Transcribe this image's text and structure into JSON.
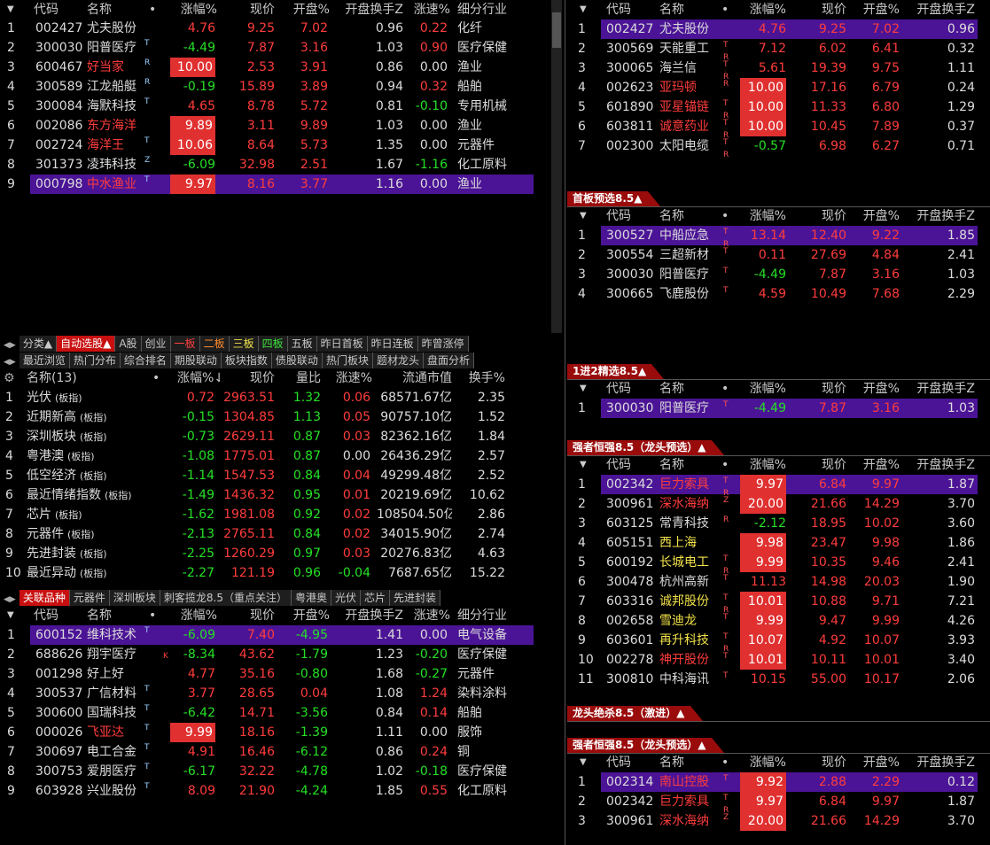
{
  "top_left": {
    "headers": [
      "代码",
      "名称",
      "•",
      "涨幅%",
      "现价",
      "开盘%",
      "开盘换手Z",
      "涨速%",
      "细分行业"
    ],
    "rows": [
      {
        "i": "1",
        "code": "002427",
        "name": "尤夫股份",
        "tag": "",
        "zf": "4.76",
        "xj": "9.25",
        "kp": "7.02",
        "hs": "0.96",
        "zs": "0.22",
        "hy": "化纤",
        "zfc": "red",
        "kpc": "red",
        "zsc": "red",
        "nc": "wht"
      },
      {
        "i": "2",
        "code": "300030",
        "name": "阳普医疗",
        "tag": "T",
        "zf": "-4.49",
        "xj": "7.87",
        "kp": "3.16",
        "hs": "1.03",
        "zs": "0.90",
        "hy": "医疗保健",
        "zfc": "grn",
        "kpc": "red",
        "zsc": "red",
        "nc": "wht"
      },
      {
        "i": "3",
        "code": "600467",
        "name": "好当家",
        "tag": "R",
        "zf": "10.00",
        "xj": "2.53",
        "kp": "3.91",
        "hs": "0.86",
        "zs": "0.00",
        "hy": "渔业",
        "zfc": "box",
        "kpc": "red",
        "zsc": "wht",
        "nc": "red"
      },
      {
        "i": "4",
        "code": "300589",
        "name": "江龙船艇",
        "tag": "R",
        "zf": "-0.19",
        "xj": "15.89",
        "kp": "3.89",
        "hs": "0.94",
        "zs": "0.32",
        "hy": "船舶",
        "zfc": "grn",
        "kpc": "red",
        "zsc": "red",
        "nc": "wht"
      },
      {
        "i": "5",
        "code": "300084",
        "name": "海默科技",
        "tag": "T",
        "zf": "4.65",
        "xj": "8.78",
        "kp": "5.72",
        "hs": "0.81",
        "zs": "-0.10",
        "hy": "专用机械",
        "zfc": "red",
        "kpc": "red",
        "zsc": "grn",
        "nc": "wht"
      },
      {
        "i": "6",
        "code": "002086",
        "name": "东方海洋",
        "tag": "",
        "zf": "9.89",
        "xj": "3.11",
        "kp": "9.89",
        "hs": "1.03",
        "zs": "0.00",
        "hy": "渔业",
        "zfc": "box",
        "kpc": "red",
        "zsc": "wht",
        "nc": "red"
      },
      {
        "i": "7",
        "code": "002724",
        "name": "海洋王",
        "tag": "T",
        "zf": "10.06",
        "xj": "8.64",
        "kp": "5.73",
        "hs": "1.35",
        "zs": "0.00",
        "hy": "元器件",
        "zfc": "box",
        "kpc": "red",
        "zsc": "wht",
        "nc": "red"
      },
      {
        "i": "8",
        "code": "301373",
        "name": "凌玮科技",
        "tag": "Z",
        "zf": "-6.09",
        "xj": "32.98",
        "kp": "2.51",
        "hs": "1.67",
        "zs": "-1.16",
        "hy": "化工原料",
        "zfc": "grn",
        "kpc": "red",
        "zsc": "grn",
        "nc": "wht"
      },
      {
        "i": "9",
        "code": "000798",
        "name": "中水渔业",
        "tag": "T",
        "zf": "9.97",
        "xj": "8.16",
        "kp": "3.77",
        "hs": "1.16",
        "zs": "0.00",
        "hy": "渔业",
        "zfc": "box",
        "kpc": "red",
        "zsc": "wht",
        "nc": "red",
        "sel": true
      }
    ]
  },
  "tabs_row1": [
    "分类▲",
    "自动选股▲",
    "A股",
    "创业",
    "一板",
    "二板",
    "三板",
    "四板",
    "五板",
    "昨日首板",
    "昨日连板",
    "昨曾涨停"
  ],
  "tabs_row2": [
    "最近浏览",
    "热门分布",
    "综合排名",
    "期股联动",
    "板块指数",
    "债股联动",
    "热门板块",
    "题材龙头",
    "盘面分析"
  ],
  "mid_left": {
    "headers": [
      "名称(13)",
      "•",
      "涨幅%↓",
      "现价",
      "量比",
      "涨速%",
      "流通市值",
      "换手%"
    ],
    "rows": [
      {
        "i": "1",
        "name": "光伏",
        "zf": "0.72",
        "xj": "2963.51",
        "lb": "1.32",
        "zs": "0.06",
        "sz": "68571.67亿",
        "hs": "2.35",
        "zfc": "red",
        "zsc": "red"
      },
      {
        "i": "2",
        "name": "近期新高",
        "zf": "-0.15",
        "xj": "1304.85",
        "lb": "1.13",
        "zs": "0.05",
        "sz": "90757.10亿",
        "hs": "1.52",
        "zfc": "grn",
        "zsc": "red"
      },
      {
        "i": "3",
        "name": "深圳板块",
        "zf": "-0.73",
        "xj": "2629.11",
        "lb": "0.87",
        "zs": "0.03",
        "sz": "82362.16亿",
        "hs": "1.84",
        "zfc": "grn",
        "zsc": "red"
      },
      {
        "i": "4",
        "name": "粤港澳",
        "zf": "-1.08",
        "xj": "1775.01",
        "lb": "0.87",
        "zs": "0.00",
        "sz": "26436.29亿",
        "hs": "2.57",
        "zfc": "grn",
        "zsc": "wht"
      },
      {
        "i": "5",
        "name": "低空经济",
        "zf": "-1.14",
        "xj": "1547.53",
        "lb": "0.84",
        "zs": "0.04",
        "sz": "49299.48亿",
        "hs": "2.52",
        "zfc": "grn",
        "zsc": "red"
      },
      {
        "i": "6",
        "name": "最近情绪指数",
        "zf": "-1.49",
        "xj": "1436.32",
        "lb": "0.95",
        "zs": "0.01",
        "sz": "20219.69亿",
        "hs": "10.62",
        "zfc": "grn",
        "zsc": "red"
      },
      {
        "i": "7",
        "name": "芯片",
        "zf": "-1.62",
        "xj": "1981.08",
        "lb": "0.92",
        "zs": "0.02",
        "sz": "108504.50亿",
        "hs": "2.86",
        "zfc": "grn",
        "zsc": "red"
      },
      {
        "i": "8",
        "name": "元器件",
        "zf": "-2.13",
        "xj": "2765.11",
        "lb": "0.84",
        "zs": "0.02",
        "sz": "34015.90亿",
        "hs": "2.74",
        "zfc": "grn",
        "zsc": "red"
      },
      {
        "i": "9",
        "name": "先进封装",
        "zf": "-2.25",
        "xj": "1260.29",
        "lb": "0.97",
        "zs": "0.03",
        "sz": "20276.83亿",
        "hs": "4.63",
        "zfc": "grn",
        "zsc": "red"
      },
      {
        "i": "10",
        "name": "最近异动",
        "zf": "-2.27",
        "xj": "121.19",
        "lb": "0.96",
        "zs": "-0.04",
        "sz": "7687.65亿",
        "hs": "15.22",
        "zfc": "grn",
        "zsc": "grn"
      }
    ],
    "suffix": "(板指)"
  },
  "tabs_row3": [
    "关联品种",
    "元器件",
    "深圳板块",
    "刺客揽龙8.5（重点关注）",
    "粤港奥",
    "光伏",
    "芯片",
    "先进封装"
  ],
  "bot_left": {
    "headers": [
      "代码",
      "名称",
      "•",
      "涨幅%",
      "现价",
      "开盘%",
      "开盘换手Z",
      "涨速%",
      "细分行业"
    ],
    "rows": [
      {
        "i": "1",
        "code": "600152",
        "name": "维科技术",
        "tag": "T",
        "zf": "-6.09",
        "xj": "7.40",
        "kp": "-4.95",
        "hs": "1.41",
        "zs": "0.00",
        "hy": "电气设备",
        "zfc": "grn",
        "kpc": "grn",
        "zsc": "wht",
        "nc": "wht",
        "sel": true
      },
      {
        "i": "2",
        "code": "688626",
        "name": "翔宇医疗",
        "tag": "K",
        "zf": "-8.34",
        "xj": "43.62",
        "kp": "-1.79",
        "hs": "1.23",
        "zs": "-0.20",
        "hy": "医疗保健",
        "zfc": "grn",
        "kpc": "grn",
        "zsc": "grn",
        "nc": "wht"
      },
      {
        "i": "3",
        "code": "001298",
        "name": "好上好",
        "tag": "",
        "zf": "4.77",
        "xj": "35.16",
        "kp": "-0.80",
        "hs": "1.68",
        "zs": "-0.27",
        "hy": "元器件",
        "zfc": "red",
        "kpc": "grn",
        "zsc": "grn",
        "nc": "wht"
      },
      {
        "i": "4",
        "code": "300537",
        "name": "广信材料",
        "tag": "T",
        "zf": "3.77",
        "xj": "28.65",
        "kp": "0.04",
        "hs": "1.08",
        "zs": "1.24",
        "hy": "染料涂料",
        "zfc": "red",
        "kpc": "red",
        "zsc": "red",
        "nc": "wht"
      },
      {
        "i": "5",
        "code": "300600",
        "name": "国瑞科技",
        "tag": "T",
        "zf": "-6.42",
        "xj": "14.71",
        "kp": "-3.56",
        "hs": "0.84",
        "zs": "0.14",
        "hy": "船舶",
        "zfc": "grn",
        "kpc": "grn",
        "zsc": "red",
        "nc": "wht"
      },
      {
        "i": "6",
        "code": "000026",
        "name": "飞亚达",
        "tag": "T",
        "zf": "9.99",
        "xj": "18.16",
        "kp": "-1.39",
        "hs": "1.11",
        "zs": "0.00",
        "hy": "服饰",
        "zfc": "box",
        "kpc": "grn",
        "zsc": "wht",
        "nc": "red"
      },
      {
        "i": "7",
        "code": "300697",
        "name": "电工合金",
        "tag": "T",
        "zf": "4.91",
        "xj": "16.46",
        "kp": "-6.12",
        "hs": "0.86",
        "zs": "0.24",
        "hy": "铜",
        "zfc": "red",
        "kpc": "grn",
        "zsc": "red",
        "nc": "wht"
      },
      {
        "i": "8",
        "code": "300753",
        "name": "爱朋医疗",
        "tag": "T",
        "zf": "-6.17",
        "xj": "32.22",
        "kp": "-4.78",
        "hs": "1.02",
        "zs": "-0.18",
        "hy": "医疗保健",
        "zfc": "grn",
        "kpc": "grn",
        "zsc": "grn",
        "nc": "wht"
      },
      {
        "i": "9",
        "code": "603928",
        "name": "兴业股份",
        "tag": "T",
        "zf": "8.09",
        "xj": "21.90",
        "kp": "-4.24",
        "hs": "1.85",
        "zs": "0.55",
        "hy": "化工原料",
        "zfc": "red",
        "kpc": "grn",
        "zsc": "red",
        "nc": "wht"
      }
    ]
  },
  "right_headers": [
    "代码",
    "名称",
    "•",
    "涨幅%",
    "现价",
    "开盘%",
    "开盘换手Z"
  ],
  "right_groups": [
    {
      "title": "",
      "rows": [
        {
          "i": "1",
          "code": "002427",
          "name": "尤夫股份",
          "tag": "",
          "zf": "4.76",
          "xj": "9.25",
          "kp": "7.02",
          "hs": "0.96",
          "zfc": "red",
          "nc": "wht",
          "sel": true
        },
        {
          "i": "2",
          "code": "300569",
          "name": "天能重工",
          "tag": "T R",
          "zf": "7.12",
          "xj": "6.02",
          "kp": "6.41",
          "hs": "0.32",
          "zfc": "red",
          "nc": "wht"
        },
        {
          "i": "3",
          "code": "300065",
          "name": "海兰信",
          "tag": "T R",
          "zf": "5.61",
          "xj": "19.39",
          "kp": "9.75",
          "hs": "1.11",
          "zfc": "red",
          "nc": "wht"
        },
        {
          "i": "4",
          "code": "002623",
          "name": "亚玛顿",
          "tag": "R",
          "zf": "10.00",
          "xj": "17.16",
          "kp": "6.79",
          "hs": "0.24",
          "zfc": "box",
          "nc": "red"
        },
        {
          "i": "5",
          "code": "601890",
          "name": "亚星锚链",
          "tag": "T R",
          "zf": "10.00",
          "xj": "11.33",
          "kp": "6.80",
          "hs": "1.29",
          "zfc": "box",
          "nc": "red"
        },
        {
          "i": "6",
          "code": "603811",
          "name": "诚意药业",
          "tag": "T R",
          "zf": "10.00",
          "xj": "10.45",
          "kp": "7.89",
          "hs": "0.37",
          "zfc": "box",
          "nc": "red"
        },
        {
          "i": "7",
          "code": "002300",
          "name": "太阳电缆",
          "tag": "T R",
          "zf": "-0.57",
          "xj": "6.98",
          "kp": "6.27",
          "hs": "0.71",
          "zfc": "grn",
          "nc": "wht"
        }
      ]
    },
    {
      "title": "首板预选8.5▲",
      "rows": [
        {
          "i": "1",
          "code": "300527",
          "name": "中船应急",
          "tag": "T R",
          "zf": "13.14",
          "xj": "12.40",
          "kp": "9.22",
          "hs": "1.85",
          "zfc": "red",
          "nc": "wht",
          "sel": true
        },
        {
          "i": "2",
          "code": "300554",
          "name": "三超新材",
          "tag": "T",
          "zf": "0.11",
          "xj": "27.69",
          "kp": "4.84",
          "hs": "2.41",
          "zfc": "red",
          "nc": "wht"
        },
        {
          "i": "3",
          "code": "300030",
          "name": "阳普医疗",
          "tag": "T",
          "zf": "-4.49",
          "xj": "7.87",
          "kp": "3.16",
          "hs": "1.03",
          "zfc": "grn",
          "nc": "wht"
        },
        {
          "i": "4",
          "code": "300665",
          "name": "飞鹿股份",
          "tag": "T",
          "zf": "4.59",
          "xj": "10.49",
          "kp": "7.68",
          "hs": "2.29",
          "zfc": "red",
          "nc": "wht"
        }
      ]
    },
    {
      "title": "1进2精选8.5▲",
      "rows": [
        {
          "i": "1",
          "code": "300030",
          "name": "阳普医疗",
          "tag": "T",
          "zf": "-4.49",
          "xj": "7.87",
          "kp": "3.16",
          "hs": "1.03",
          "zfc": "grn",
          "nc": "wht",
          "sel": true
        }
      ]
    },
    {
      "title": "强者恒强8.5（龙头预选）▲",
      "rows": [
        {
          "i": "1",
          "code": "002342",
          "name": "巨力索具",
          "tag": "T R",
          "zf": "9.97",
          "xj": "6.84",
          "kp": "9.97",
          "hs": "1.87",
          "zfc": "box",
          "nc": "red",
          "sel": true
        },
        {
          "i": "2",
          "code": "300961",
          "name": "深水海纳",
          "tag": "Z",
          "zf": "20.00",
          "xj": "21.66",
          "kp": "14.29",
          "hs": "3.70",
          "zfc": "box",
          "nc": "red"
        },
        {
          "i": "3",
          "code": "603125",
          "name": "常青科技",
          "tag": "R",
          "zf": "-2.12",
          "xj": "18.95",
          "kp": "10.02",
          "hs": "3.60",
          "zfc": "grn",
          "nc": "wht"
        },
        {
          "i": "4",
          "code": "605151",
          "name": "西上海",
          "tag": "",
          "zf": "9.98",
          "xj": "23.47",
          "kp": "9.98",
          "hs": "1.86",
          "zfc": "box",
          "nc": "yel"
        },
        {
          "i": "5",
          "code": "600192",
          "name": "长城电工",
          "tag": "T R",
          "zf": "9.99",
          "xj": "10.35",
          "kp": "9.46",
          "hs": "2.41",
          "zfc": "box",
          "nc": "yel"
        },
        {
          "i": "6",
          "code": "300478",
          "name": "杭州高新",
          "tag": "T",
          "zf": "11.13",
          "xj": "14.98",
          "kp": "20.03",
          "hs": "1.90",
          "zfc": "red",
          "nc": "wht"
        },
        {
          "i": "7",
          "code": "603316",
          "name": "诚邦股份",
          "tag": "T R",
          "zf": "10.01",
          "xj": "10.88",
          "kp": "9.71",
          "hs": "7.21",
          "zfc": "box",
          "nc": "yel"
        },
        {
          "i": "8",
          "code": "002658",
          "name": "雪迪龙",
          "tag": "T",
          "zf": "9.99",
          "xj": "9.47",
          "kp": "9.99",
          "hs": "4.26",
          "zfc": "box",
          "nc": "yel"
        },
        {
          "i": "9",
          "code": "603601",
          "name": "再升科技",
          "tag": "T R",
          "zf": "10.07",
          "xj": "4.92",
          "kp": "10.07",
          "hs": "3.93",
          "zfc": "box",
          "nc": "yel"
        },
        {
          "i": "10",
          "code": "002278",
          "name": "神开股份",
          "tag": "T",
          "zf": "10.01",
          "xj": "10.11",
          "kp": "10.01",
          "hs": "3.40",
          "zfc": "box",
          "nc": "red"
        },
        {
          "i": "11",
          "code": "300810",
          "name": "中科海讯",
          "tag": "T",
          "zf": "10.15",
          "xj": "55.00",
          "kp": "10.17",
          "hs": "2.06",
          "zfc": "red",
          "nc": "wht"
        }
      ]
    },
    {
      "title": "龙头绝杀8.5（激进）▲",
      "rows": []
    },
    {
      "title": "强者恒强8.5（龙头预选）▲",
      "rows": [
        {
          "i": "1",
          "code": "002314",
          "name": "南山控股",
          "tag": "T",
          "zf": "9.92",
          "xj": "2.88",
          "kp": "2.29",
          "hs": "0.12",
          "zfc": "box",
          "nc": "red",
          "sel": true
        },
        {
          "i": "2",
          "code": "002342",
          "name": "巨力索具",
          "tag": "T R",
          "zf": "9.97",
          "xj": "6.84",
          "kp": "9.97",
          "hs": "1.87",
          "zfc": "box",
          "nc": "red"
        },
        {
          "i": "3",
          "code": "300961",
          "name": "深水海纳",
          "tag": "Z",
          "zf": "20.00",
          "xj": "21.66",
          "kp": "14.29",
          "hs": "3.70",
          "zfc": "box",
          "nc": "red"
        }
      ]
    }
  ],
  "colors": {
    "up": "#ff3c3c",
    "down": "#25e025",
    "selected": "#4b1496",
    "limit_box": "#e03030",
    "group_header": "#9a0b0b"
  }
}
